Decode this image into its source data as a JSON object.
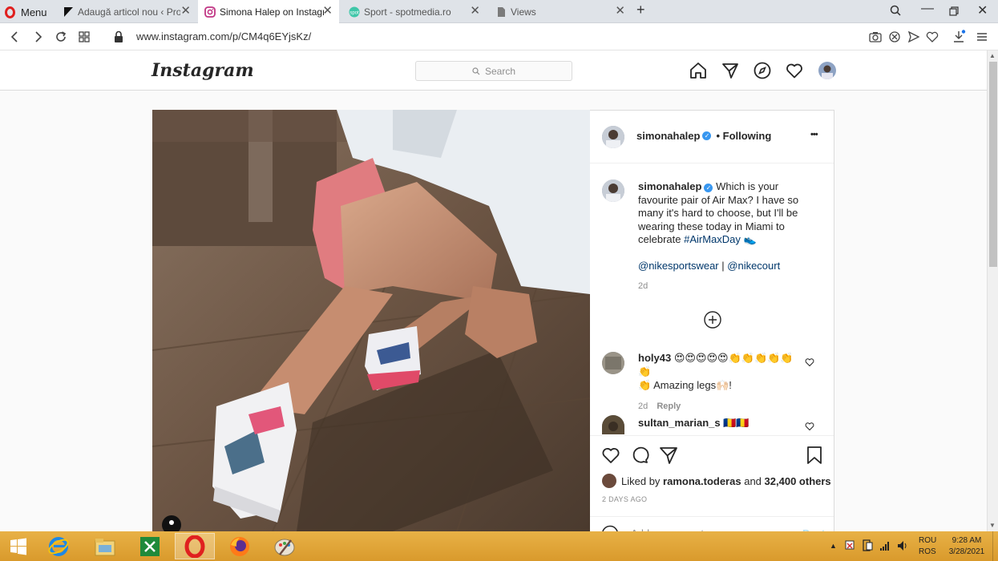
{
  "browser": {
    "menu_label": "Menu",
    "tabs": [
      {
        "title": "Adaugă articol nou ‹ Prosp",
        "icon": "wordpress-flag-icon"
      },
      {
        "title": "Simona Halep on Instagram",
        "icon": "instagram-icon"
      },
      {
        "title": "Sport - spotmedia.ro",
        "icon": "spotmedia-icon"
      },
      {
        "title": "Views",
        "icon": "document-icon"
      }
    ],
    "new_tab": "+",
    "url": "www.instagram.com/p/CM4q6EYjsKz/"
  },
  "instagram": {
    "logo": "Instagram",
    "search_placeholder": "Search",
    "post": {
      "username": "simonahalep",
      "follow_state": "• Following",
      "more": "•••",
      "caption_text": "Which is your favourite pair of Air Max? I have so many it's hard to choose, but I'll be wearing these today in Miami to celebrate",
      "hashtag": "#AirMaxDay",
      "emoji_after_hashtag": "👟",
      "mention_1": "@nikesportswear",
      "separator": "|",
      "mention_2": "@nikecourt",
      "caption_age": "2d",
      "comments": [
        {
          "user": "holy43",
          "text_line1": "😍😍😍😍😍👏👏👏👏👏👏",
          "text_line2": "👏 Amazing legs🙌🏻!",
          "age": "2d",
          "reply": "Reply"
        },
        {
          "user": "sultan_marian_s",
          "text": "🇷🇴🇷🇴"
        }
      ],
      "liked_by_prefix": "Liked by",
      "liked_by_user": "ramona.toderas",
      "liked_by_and": "and",
      "liked_by_others": "32,400 others",
      "post_date": "2 DAYS AGO",
      "add_comment_placeholder": "Add a comment...",
      "post_button": "Post"
    }
  },
  "taskbar": {
    "lang_top": "ROU",
    "lang_bottom": "ROS",
    "time": "9:28 AM",
    "date": "3/28/2021"
  },
  "colors": {
    "opera_red": "#e0201f",
    "ig_link": "#00376b",
    "verified_blue": "#3897f0",
    "taskbar": "#e0a63a"
  }
}
